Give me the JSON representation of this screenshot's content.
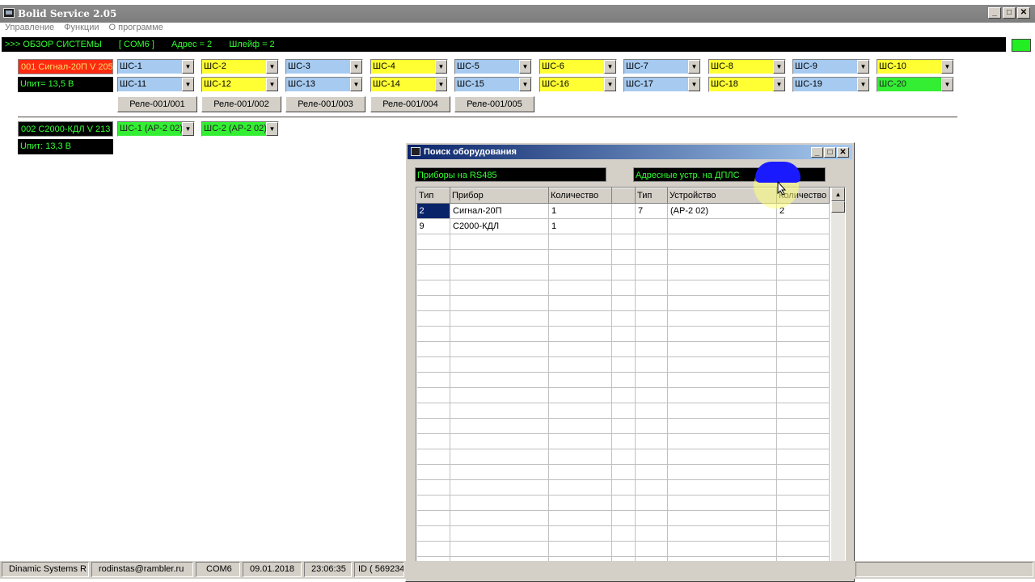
{
  "window": {
    "title": "Bolid Service 2.05",
    "btn_min": "_",
    "btn_max": "□",
    "btn_close": "✕"
  },
  "menu": [
    "Управление",
    "Функции",
    "О программе"
  ],
  "status": {
    "prefix": ">>> ОБЗОР СИСТЕМЫ",
    "port": "[ COM6 ]",
    "address": "Адрес = 2",
    "loop": "Шлейф = 2"
  },
  "devices": [
    {
      "name": "001  Сигнал-20П V 205",
      "voltage": "Uпит= 13,5 В"
    },
    {
      "name": "002  С2000-КДЛ V 213",
      "voltage": "Uпит:   13,3 В"
    }
  ],
  "zones_row1": [
    {
      "label": "ШС-1",
      "color": "blue"
    },
    {
      "label": "ШС-2",
      "color": "yellow"
    },
    {
      "label": "ШС-3",
      "color": "blue"
    },
    {
      "label": "ШС-4",
      "color": "yellow"
    },
    {
      "label": "ШС-5",
      "color": "blue"
    },
    {
      "label": "ШС-6",
      "color": "yellow"
    },
    {
      "label": "ШС-7",
      "color": "blue"
    },
    {
      "label": "ШС-8",
      "color": "yellow"
    },
    {
      "label": "ШС-9",
      "color": "blue"
    },
    {
      "label": "ШС-10",
      "color": "yellow"
    }
  ],
  "zones_row2": [
    {
      "label": "ШС-11",
      "color": "blue"
    },
    {
      "label": "ШС-12",
      "color": "yellow"
    },
    {
      "label": "ШС-13",
      "color": "blue"
    },
    {
      "label": "ШС-14",
      "color": "yellow"
    },
    {
      "label": "ШС-15",
      "color": "blue"
    },
    {
      "label": "ШС-16",
      "color": "yellow"
    },
    {
      "label": "ШС-17",
      "color": "blue"
    },
    {
      "label": "ШС-18",
      "color": "yellow"
    },
    {
      "label": "ШС-19",
      "color": "blue"
    },
    {
      "label": "ШС-20",
      "color": "green"
    }
  ],
  "relays": [
    "Реле-001/001",
    "Реле-001/002",
    "Реле-001/003",
    "Реле-001/004",
    "Реле-001/005"
  ],
  "dev2_zones": [
    {
      "label": "ШС-1 (АР-2 02)",
      "color": "green"
    },
    {
      "label": "ШС-2 (АР-2 02)",
      "color": "green"
    }
  ],
  "colors": {
    "blue": "#a6caf0",
    "yellow": "#ffff33",
    "green": "#33ee33",
    "alarm_red": "#ff2a12"
  },
  "dialog": {
    "title": "Поиск оборудования",
    "left_label": "Приборы на RS485",
    "right_label": "Адресные устр. на ДПЛС",
    "headers": [
      "Тип",
      "Прибор",
      "Количество",
      "",
      "Тип",
      "Устройство",
      "Количество"
    ],
    "rows": [
      [
        "2",
        "Сигнал-20П",
        "1",
        "",
        "7",
        "(АР-2 02)",
        "2"
      ],
      [
        "9",
        "С2000-КДЛ",
        "1",
        "",
        "",
        "",
        ""
      ]
    ]
  },
  "bottombar": [
    "Dinamic Systems R",
    "rodinstas@rambler.ru",
    "COM6",
    "09.01.2018",
    "23:06:35",
    "ID ( 569234"
  ]
}
